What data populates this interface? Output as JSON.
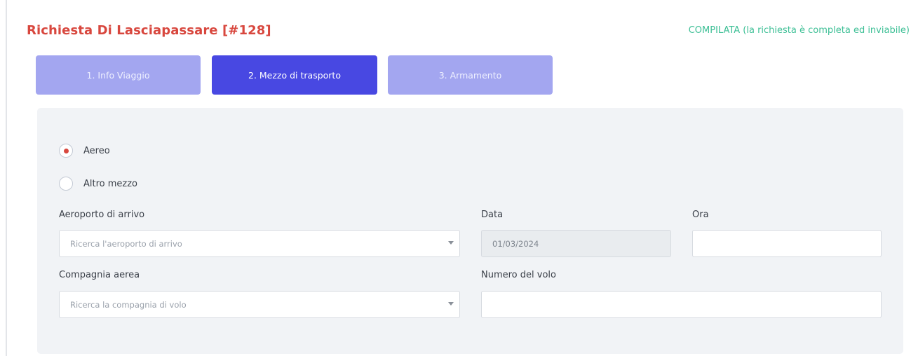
{
  "header": {
    "title": "Richiesta Di Lasciapassare [#128]",
    "status": "COMPILATA (la richiesta è completa ed inviabile)"
  },
  "tabs": [
    {
      "label": "1. Info Viaggio",
      "active": false
    },
    {
      "label": "2. Mezzo di trasporto",
      "active": true
    },
    {
      "label": "3. Armamento",
      "active": false
    }
  ],
  "transport": {
    "options": [
      {
        "label": "Aereo",
        "checked": true
      },
      {
        "label": "Altro mezzo",
        "checked": false
      }
    ]
  },
  "form": {
    "airport_label": "Aeroporto di arrivo",
    "airport_placeholder": "Ricerca l'aeroporto di arrivo",
    "date_label": "Data",
    "date_value": "01/03/2024",
    "time_label": "Ora",
    "time_value": "",
    "airline_label": "Compagnia aerea",
    "airline_placeholder": "Ricerca la compagnia di volo",
    "flight_label": "Numero del volo",
    "flight_value": ""
  },
  "colors": {
    "title": "#d8473e",
    "status": "#3cbf95",
    "tab_active": "#4848e2",
    "tab_inactive": "#a3a6f0",
    "panel": "#f1f3f6"
  }
}
